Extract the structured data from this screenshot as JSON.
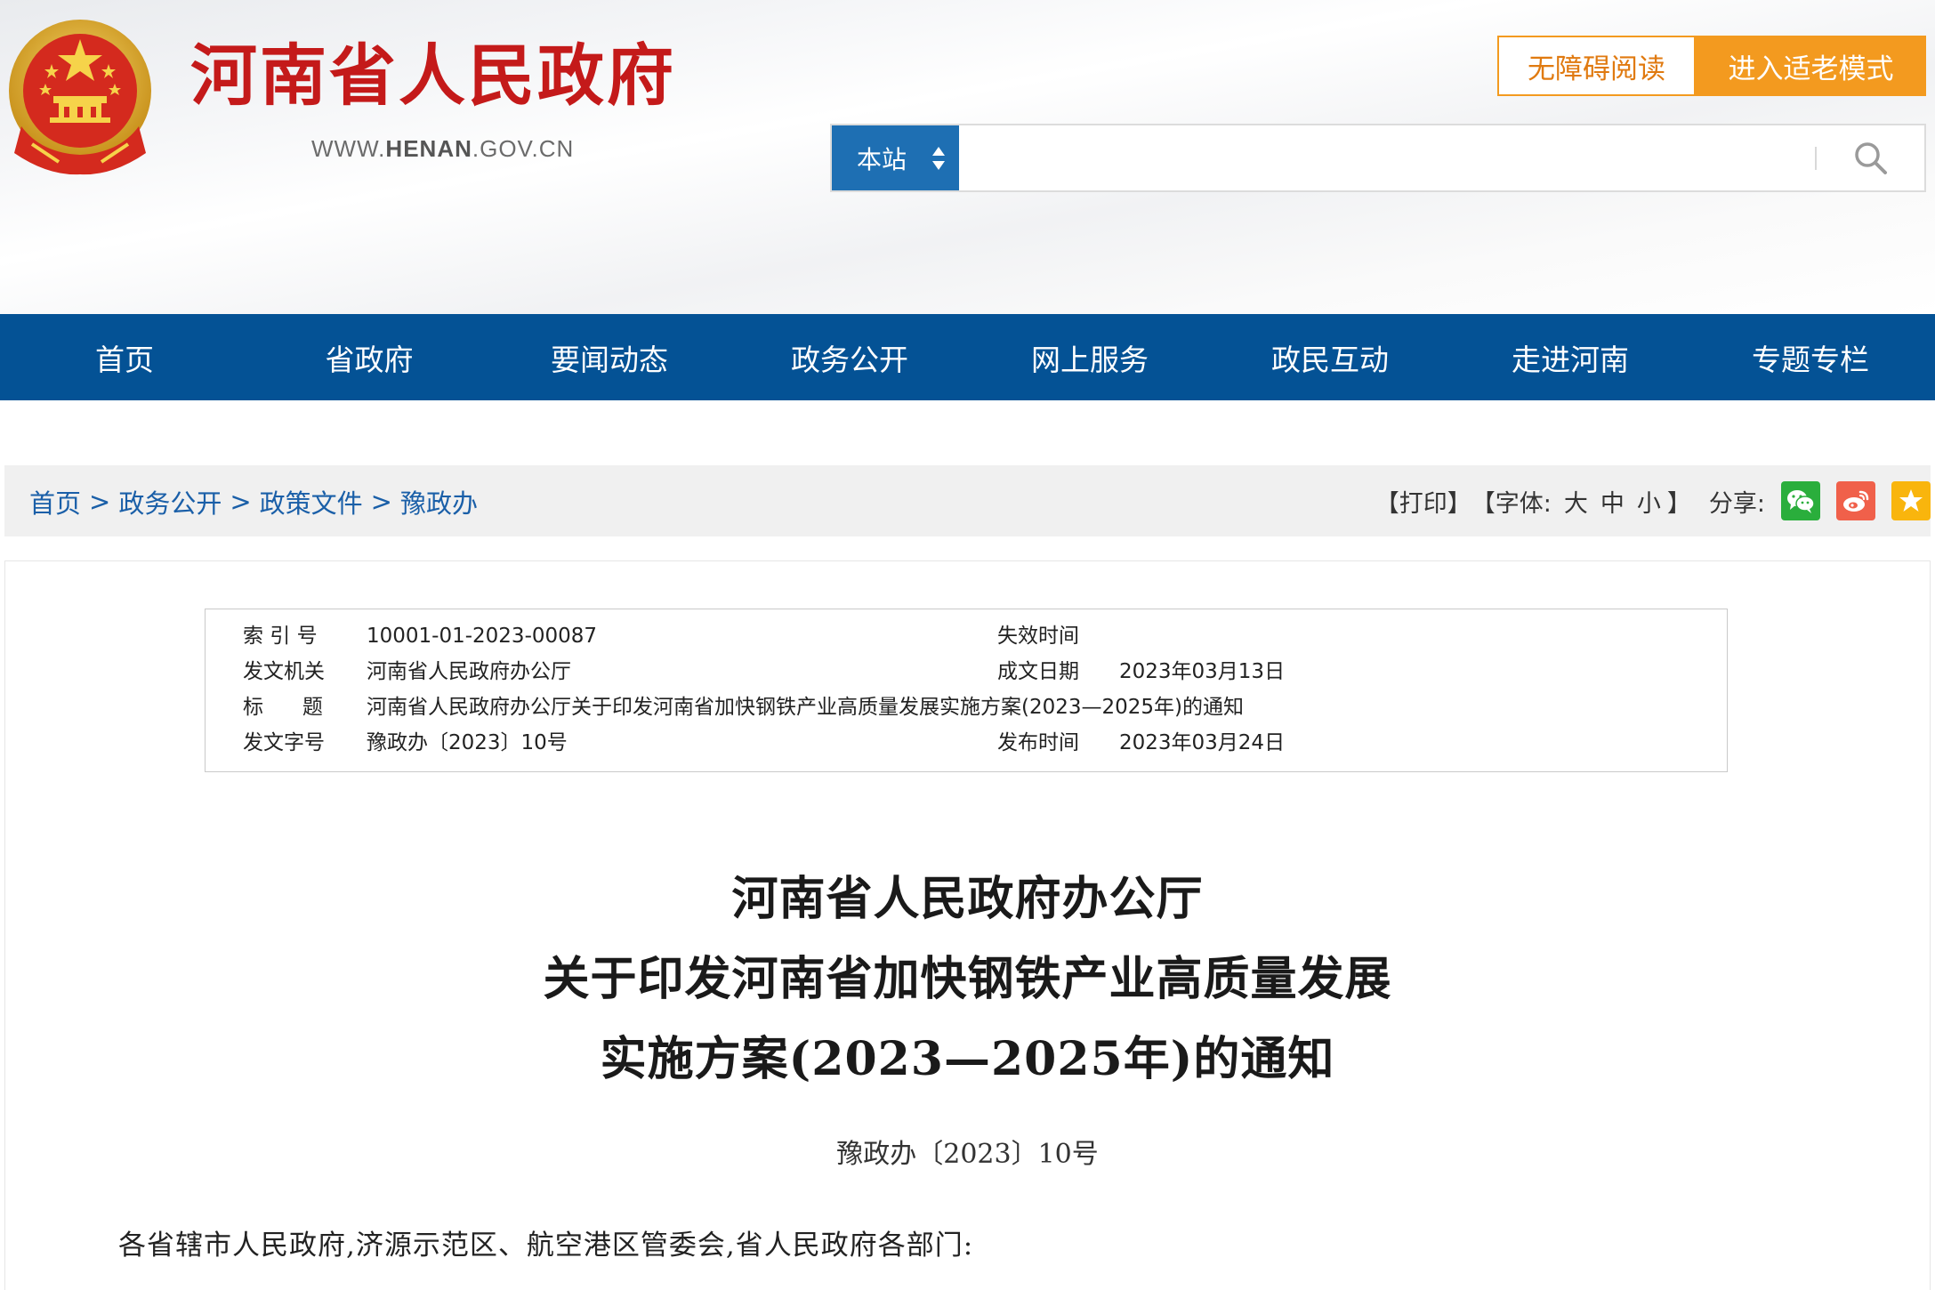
{
  "header": {
    "site_title": "河南省人民政府",
    "site_url_prefix": "WWW.",
    "site_url_bold": "HENAN",
    "site_url_suffix": ".GOV.CN",
    "accessibility_label": "无障碍阅读",
    "elder_mode_label": "进入适老模式",
    "search": {
      "scope_label": "本站",
      "placeholder": ""
    }
  },
  "nav": {
    "items": [
      "首页",
      "省政府",
      "要闻动态",
      "政务公开",
      "网上服务",
      "政民互动",
      "走进河南",
      "专题专栏"
    ]
  },
  "breadcrumb": {
    "items": [
      "首页",
      "政务公开",
      "政策文件",
      "豫政办"
    ],
    "separator": ">"
  },
  "tools": {
    "print": "【打印】",
    "font_prefix": "【字体:",
    "font_large": "大",
    "font_medium": "中",
    "font_small": "小",
    "font_suffix": "】",
    "share_label": "分享:",
    "share_icons": [
      "wechat-icon",
      "weibo-icon",
      "favorite-star-icon"
    ]
  },
  "meta": {
    "index_no_label": "索 引 号",
    "index_no": "10001-01-2023-00087",
    "expiry_label": "失效时间",
    "expiry": "",
    "issuer_label": "发文机关",
    "issuer": "河南省人民政府办公厅",
    "written_date_label": "成文日期",
    "written_date": "2023年03月13日",
    "title_label": "标      题",
    "title": "河南省人民政府办公厅关于印发河南省加快钢铁产业高质量发展实施方案(2023—2025年)的通知",
    "doc_no_label": "发文字号",
    "doc_no": "豫政办〔2023〕10号",
    "publish_date_label": "发布时间",
    "publish_date": "2023年03月24日"
  },
  "document": {
    "title_line1": "河南省人民政府办公厅",
    "title_line2": "关于印发河南省加快钢铁产业高质量发展",
    "title_line3": "实施方案(2023—2025年)的通知",
    "doc_number": "豫政办〔2023〕10号",
    "salutation": "各省辖市人民政府,济源示范区、航空港区管委会,省人民政府各部门:"
  },
  "colors": {
    "brand_red": "#c41a1a",
    "nav_blue": "#045295",
    "accent_orange": "#f39a1f",
    "search_blue": "#1e6fb3",
    "link_blue": "#1a5fa8",
    "wechat_green": "#2aae3c",
    "weibo_red": "#f0604a",
    "favorite_orange": "#f9b50d"
  }
}
